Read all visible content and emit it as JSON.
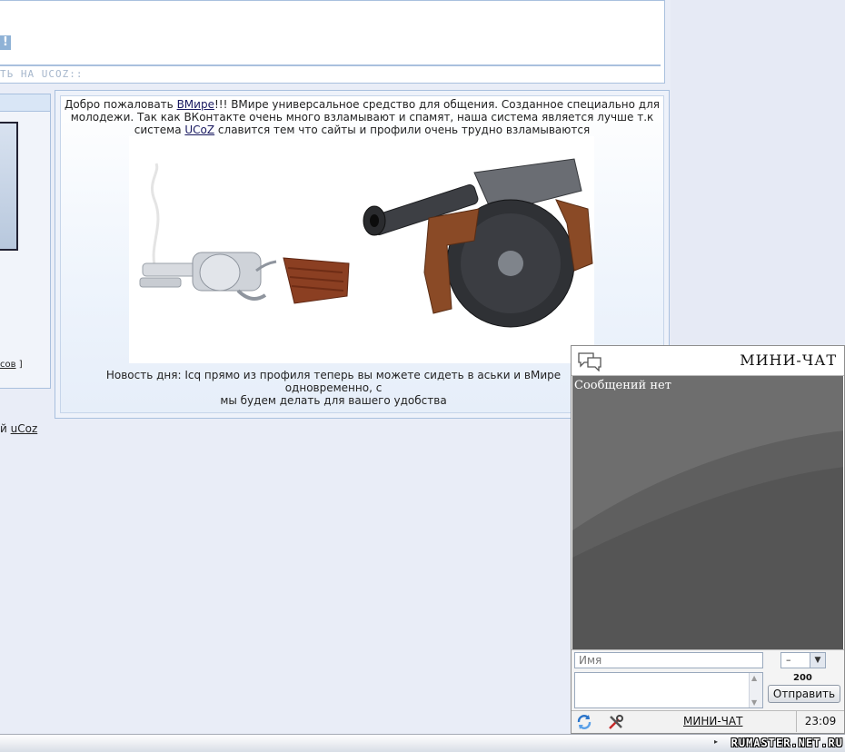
{
  "header": {
    "exclaim": "!",
    "ucoz_caption": "ТЬ НА UCOZ::"
  },
  "left": {
    "sov_link": "сов",
    "sov_bracket": "]",
    "ucoz_prefix": "й ",
    "ucoz_link": "uCoz"
  },
  "main": {
    "welcome_pre": "Добро пожаловать ",
    "welcome_link": "ВМире",
    "welcome_mid": "!!! ВМире универсальное средство для общения. Созданное специально для молодежи. Так как ВКонтакте очень много взламывают и спамят, наша система является лучше т.к система ",
    "welcome_link2": "UCoZ",
    "welcome_post": " славится тем что сайты и профили очень трудно взламываются",
    "news_line1": "Новость дня: Icq прямо из профиля теперь вы можете сидеть в аськи и вМире одновременно, с",
    "news_line2": "мы будем делать для вашего удобства"
  },
  "chat": {
    "title": "МИНИ-ЧАТ",
    "empty_text": "Сообщений нет",
    "name_placeholder": "Имя",
    "smile_value": "–",
    "char_limit": "200",
    "send_label": "Отправить",
    "footer_link": "МИНИ-ЧАТ",
    "time": "23:09",
    "icons": {
      "header": "chat-bubbles-icon",
      "refresh": "refresh-icon",
      "tools": "tools-icon"
    }
  },
  "watermark": "RUMASTER.NET.RU"
}
